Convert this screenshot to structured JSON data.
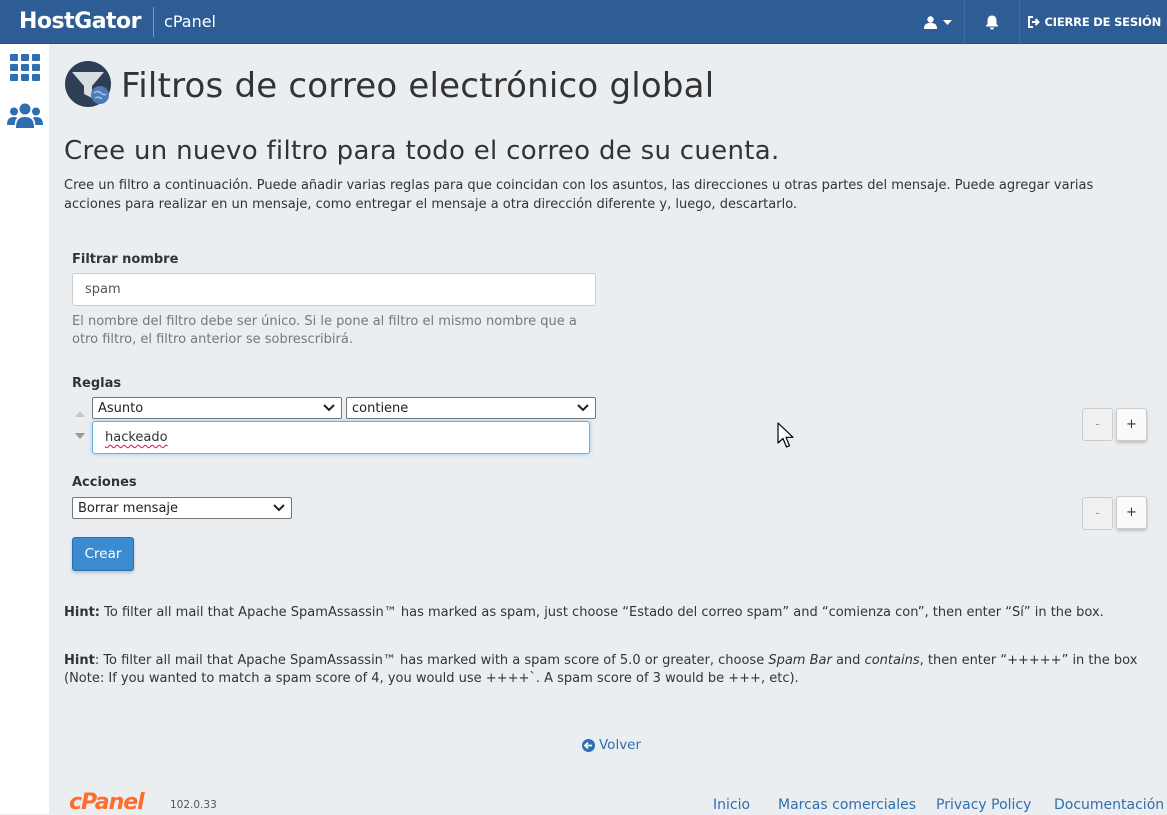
{
  "topbar": {
    "brand": "HostGator",
    "product": "cPanel",
    "logout_label": "CIERRE DE SESIÓN"
  },
  "page": {
    "title": "Filtros de correo electrónico global",
    "subtitle": "Cree un nuevo filtro para todo el correo de su cuenta.",
    "description": "Cree un filtro a continuación. Puede añadir varias reglas para que coincidan con los asuntos, las direcciones u otras partes del mensaje. Puede agregar varias acciones para realizar en un mensaje, como entregar el mensaje a otra dirección diferente y, luego, descartarlo."
  },
  "form": {
    "filter_name_label": "Filtrar nombre",
    "filter_name_value": "spam",
    "filter_name_help": "El nombre del filtro debe ser único. Si le pone al filtro el mismo nombre que a otro filtro, el filtro anterior se sobrescribirá.",
    "rules_label": "Reglas",
    "rule_field": "Asunto",
    "rule_operator": "contiene",
    "rule_value": "hackeado",
    "actions_label": "Acciones",
    "action_value": "Borrar mensaje",
    "minus": "-",
    "plus": "+",
    "create_button": "Crear"
  },
  "hints": {
    "hint1_label": "Hint:",
    "hint1_text": " To filter all mail that Apache SpamAssassin™ has marked as spam, just choose “Estado del correo spam” and “comienza con”, then enter “Sí” in the box.",
    "hint2_label": "Hint",
    "hint2_a": ": To filter all mail that Apache SpamAssassin™ has marked with a spam score of 5.0 or greater, choose ",
    "hint2_em1": "Spam Bar",
    "hint2_b": " and ",
    "hint2_em2": "contains",
    "hint2_c": ", then enter “+++++” in the box (Note: If you wanted to match a spam score of 4, you would use ++++`. A spam score of 3 would be +++, etc)."
  },
  "back_link": "Volver",
  "footer": {
    "logo": "cPanel",
    "version": "102.0.33",
    "links": [
      "Inicio",
      "Marcas comerciales",
      "Privacy Policy",
      "Documentación"
    ]
  },
  "icons": [
    "user-icon",
    "caret-down-icon",
    "bell-icon",
    "logout-icon",
    "apps-grid-icon",
    "users-icon",
    "global-filter-icon",
    "chevron-down-icon",
    "sort-up-icon",
    "sort-down-icon",
    "back-arrow-icon"
  ],
  "colors": {
    "topbar": "#2e5c94",
    "primary": "#3b8bd1",
    "link": "#2e6fb1",
    "cpanel_orange": "#ff6c2c"
  }
}
